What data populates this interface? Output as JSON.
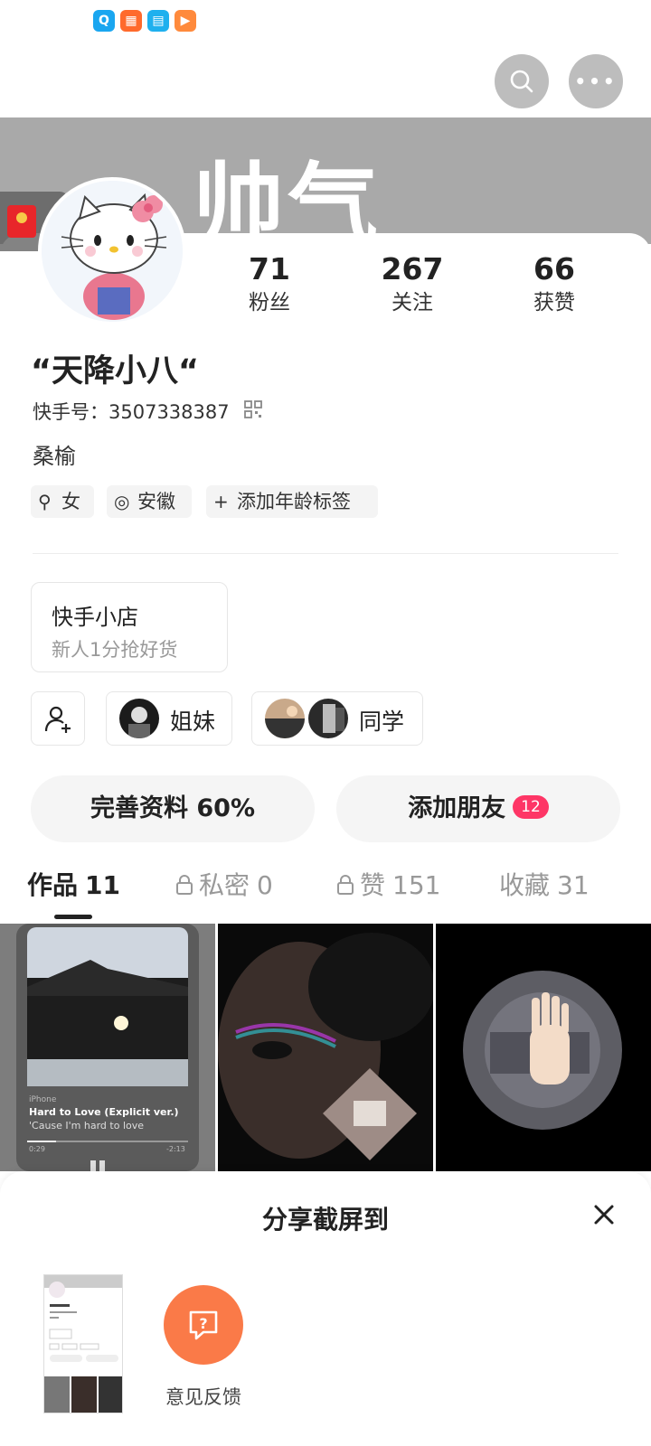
{
  "status_bar": {
    "app_icons": [
      {
        "name": "search-app-icon",
        "glyph": "Q",
        "color": "#1aa6f0"
      },
      {
        "name": "grid-app-icon",
        "glyph": "▦",
        "color": "#ff6a2c"
      },
      {
        "name": "book-app-icon",
        "glyph": "▤",
        "color": "#1fb0ee"
      },
      {
        "name": "play-app-icon",
        "glyph": "▶",
        "color": "#ff8a3c"
      }
    ]
  },
  "banner": {
    "text": "帅气"
  },
  "profile": {
    "stats": [
      {
        "value": "71",
        "label": "粉丝"
      },
      {
        "value": "267",
        "label": "关注"
      },
      {
        "value": "66",
        "label": "获赞"
      }
    ],
    "nickname": "“天降小八“",
    "kuaishou_id_label": "快手号：",
    "kuaishou_id": "3507338387",
    "bio": "桑榆",
    "tags": [
      {
        "icon": "⚲",
        "label": "女"
      },
      {
        "icon": "◎",
        "label": "安徽"
      },
      {
        "icon": "+",
        "label": "添加年龄标签"
      }
    ]
  },
  "shop": {
    "title": "快手小店",
    "subtitle": "新人1分抢好货"
  },
  "groups": [
    {
      "label": "姐妹"
    },
    {
      "label": "同学"
    }
  ],
  "actions": {
    "complete_profile": "完善资料 60%",
    "add_friends": "添加朋友",
    "add_friends_badge": "12"
  },
  "tabs": [
    {
      "label": "作品",
      "count": "11",
      "locked": false
    },
    {
      "label": "私密",
      "count": "0",
      "locked": true
    },
    {
      "label": "赞",
      "count": "151",
      "locked": true
    },
    {
      "label": "收藏",
      "count": "31",
      "locked": false
    }
  ],
  "thumbnails": {
    "music": {
      "device": "iPhone",
      "song": "Hard to Love (Explicit ver.)",
      "lyric": "'Cause I'm hard to love",
      "elapsed": "0:29",
      "remaining": "-2:13",
      "progress": 0.18
    }
  },
  "share_sheet": {
    "title": "分享截屏到",
    "feedback_label": "意见反馈"
  }
}
